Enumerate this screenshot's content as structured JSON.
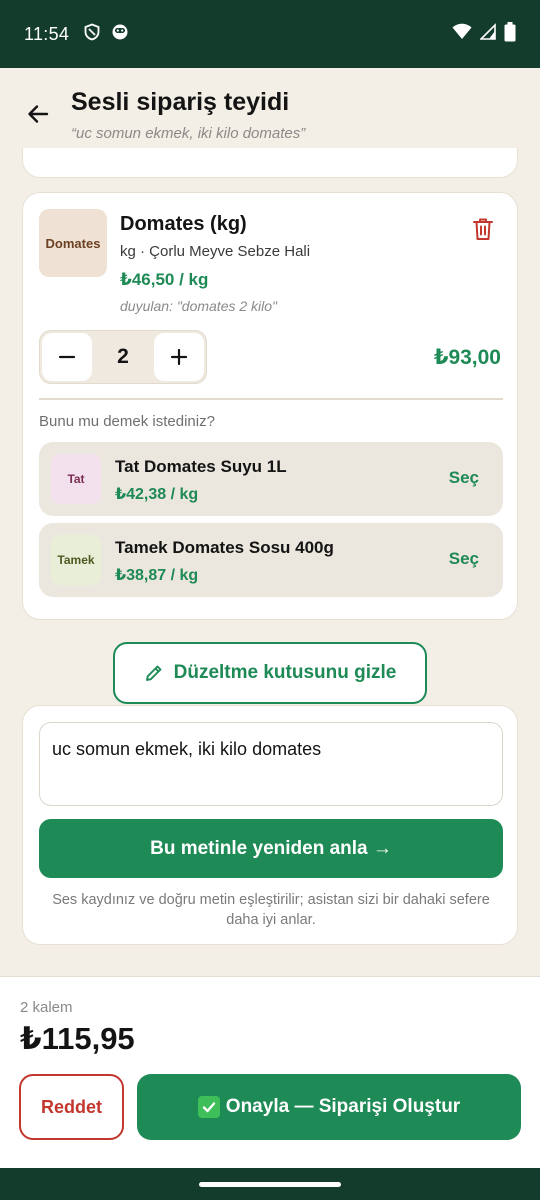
{
  "status_bar": {
    "time": "11:54"
  },
  "header": {
    "title": "Sesli sipariş teyidi",
    "subtitle": "“uc somun ekmek, iki kilo domates”"
  },
  "product": {
    "thumb_label": "Domates",
    "name": "Domates (kg)",
    "meta": "kg · Çorlu Meyve Sebze Hali",
    "unit_price": "₺46,50 / kg",
    "heard": "duyulan: \"domates 2 kilo\"",
    "quantity": "2",
    "line_total": "₺93,00"
  },
  "suggestions": {
    "label": "Bunu mu demek istediniz?",
    "items": [
      {
        "thumb_label": "Tat",
        "name": "Tat Domates Suyu 1L",
        "price": "₺42,38 / kg",
        "select_label": "Seç",
        "thumb_bg": "#f2e1ec",
        "thumb_color": "#7a2c52"
      },
      {
        "thumb_label": "Tamek",
        "name": "Tamek Domates Sosu 400g",
        "price": "₺38,87 / kg",
        "select_label": "Seç",
        "thumb_bg": "#e9eed9",
        "thumb_color": "#4b5a1f"
      }
    ]
  },
  "edit": {
    "toggle_label": "Düzeltme kutusunu gizle",
    "text": "uc somun ekmek, iki kilo domates",
    "reparse_label": "Bu metinle yeniden anla →",
    "hint": "Ses kaydınız ve doğru metin eşleştirilir; asistan sizi bir dahaki sefere daha iyi anlar."
  },
  "footer": {
    "item_count": "2 kalem",
    "total": "₺115,95",
    "reject_label": "Reddet",
    "confirm_label": "Onayla — Siparişi Oluştur"
  },
  "colors": {
    "accent": "#1e8a56",
    "danger": "#c2382f",
    "bar": "#143c2c",
    "background": "#f4efe6"
  },
  "icons": [
    "shield-icon",
    "face-icon",
    "wifi-icon",
    "signal-icon",
    "battery-icon",
    "back-arrow-icon",
    "trash-icon",
    "minus-icon",
    "plus-icon",
    "pencil-icon",
    "check-emoji-icon"
  ]
}
